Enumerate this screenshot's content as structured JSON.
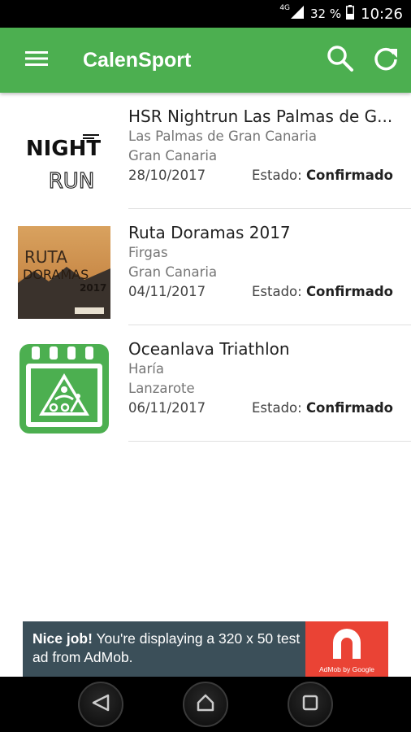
{
  "status_bar": {
    "network": "4G",
    "battery": "32 %",
    "time": "10:26"
  },
  "app_bar": {
    "title": "CalenSport",
    "menu_icon": "hamburger-menu-icon",
    "search_icon": "search-icon",
    "refresh_icon": "refresh-icon",
    "background_color": "#4caf50"
  },
  "events": [
    {
      "name": "HSR Nightrun Las Palmas de G...",
      "location": "Las Palmas de Gran Canaria",
      "island": "Gran Canaria",
      "date": "28/10/2017",
      "status_label": "Estado:",
      "status_value": "Confirmado",
      "thumb_text_top": "NIGHT",
      "thumb_text_bottom": "RUN"
    },
    {
      "name": "Ruta Doramas 2017",
      "location": "Firgas",
      "island": "Gran Canaria",
      "date": "04/11/2017",
      "status_label": "Estado:",
      "status_value": "Confirmado",
      "thumb_text_top": "RUTA",
      "thumb_text_mid": "DORAMAS",
      "thumb_text_year": "2017"
    },
    {
      "name": "Oceanlava Triathlon",
      "location": "Haría",
      "island": "Lanzarote",
      "date": "06/11/2017",
      "status_label": "Estado:",
      "status_value": "Confirmado",
      "thumb_icon": "triathlon-calendar-icon"
    }
  ],
  "ad": {
    "headline": "Nice job!",
    "body": "You're displaying a 320 x 50 test ad from AdMob.",
    "logo_caption": "AdMob by Google",
    "logo_color": "#ea4335"
  },
  "nav_bar": {
    "back_icon": "back-triangle-icon",
    "home_icon": "home-icon",
    "recents_icon": "recents-square-icon"
  }
}
